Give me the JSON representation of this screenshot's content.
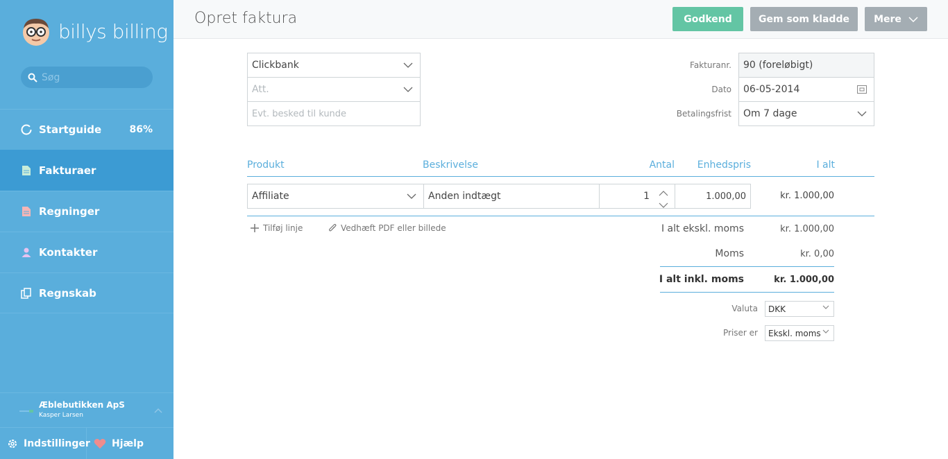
{
  "app": {
    "brand": "billys billing"
  },
  "search": {
    "placeholder": "Søg"
  },
  "nav": {
    "items": [
      {
        "label": "Startguide",
        "percent": "86%"
      },
      {
        "label": "Fakturaer"
      },
      {
        "label": "Regninger"
      },
      {
        "label": "Kontakter"
      },
      {
        "label": "Regnskab"
      }
    ]
  },
  "company": {
    "name": "Æblebutikken ApS",
    "user": "Kasper Larsen"
  },
  "bottom": {
    "settings": "Indstillinger",
    "help": "Hjælp"
  },
  "header": {
    "title": "Opret faktura",
    "approve": "Godkend",
    "save_draft": "Gem som kladde",
    "more": "Mere"
  },
  "customer": {
    "contact": "Clickbank",
    "att_placeholder": "Att.",
    "message_placeholder": "Evt. besked til kunde"
  },
  "invoice_meta": {
    "number_label": "Fakturanr.",
    "number": "90 (foreløbigt)",
    "date_label": "Dato",
    "date": "06-05-2014",
    "due_label": "Betalingsfrist",
    "due": "Om 7 dage"
  },
  "table": {
    "headers": {
      "product": "Produkt",
      "description": "Beskrivelse",
      "quantity": "Antal",
      "unit_price": "Enhedspris",
      "total": "I alt"
    },
    "rows": [
      {
        "product": "Affiliate",
        "description": "Anden indtægt",
        "quantity": "1",
        "unit_price": "1.000,00",
        "total": "kr. 1.000,00"
      }
    ]
  },
  "actions": {
    "add_line": "Tilføj linje",
    "attach": "Vedhæft PDF eller billede"
  },
  "summary": {
    "subtotal_label": "I alt ekskl. moms",
    "subtotal": "kr. 1.000,00",
    "vat_label": "Moms",
    "vat": "kr. 0,00",
    "total_label": "I alt inkl. moms",
    "total": "kr. 1.000,00"
  },
  "settings": {
    "currency_label": "Valuta",
    "currency": "DKK",
    "prices_label": "Priser er",
    "prices": "Ekskl. moms"
  },
  "colors": {
    "sidebar": "#5aaedc",
    "active": "#3c9bd3",
    "approve": "#63c5a4",
    "grey_button": "#a4adb3",
    "accent": "#5aaedc"
  },
  "icons": [
    "search-icon",
    "startguide-ring-icon",
    "invoice-icon",
    "bill-icon",
    "contact-icon",
    "accounting-icon",
    "gear-icon",
    "heart-icon",
    "chevron-down-icon",
    "calendar-icon",
    "plus-icon",
    "paperclip-icon",
    "stepper-up-icon",
    "stepper-down-icon"
  ]
}
